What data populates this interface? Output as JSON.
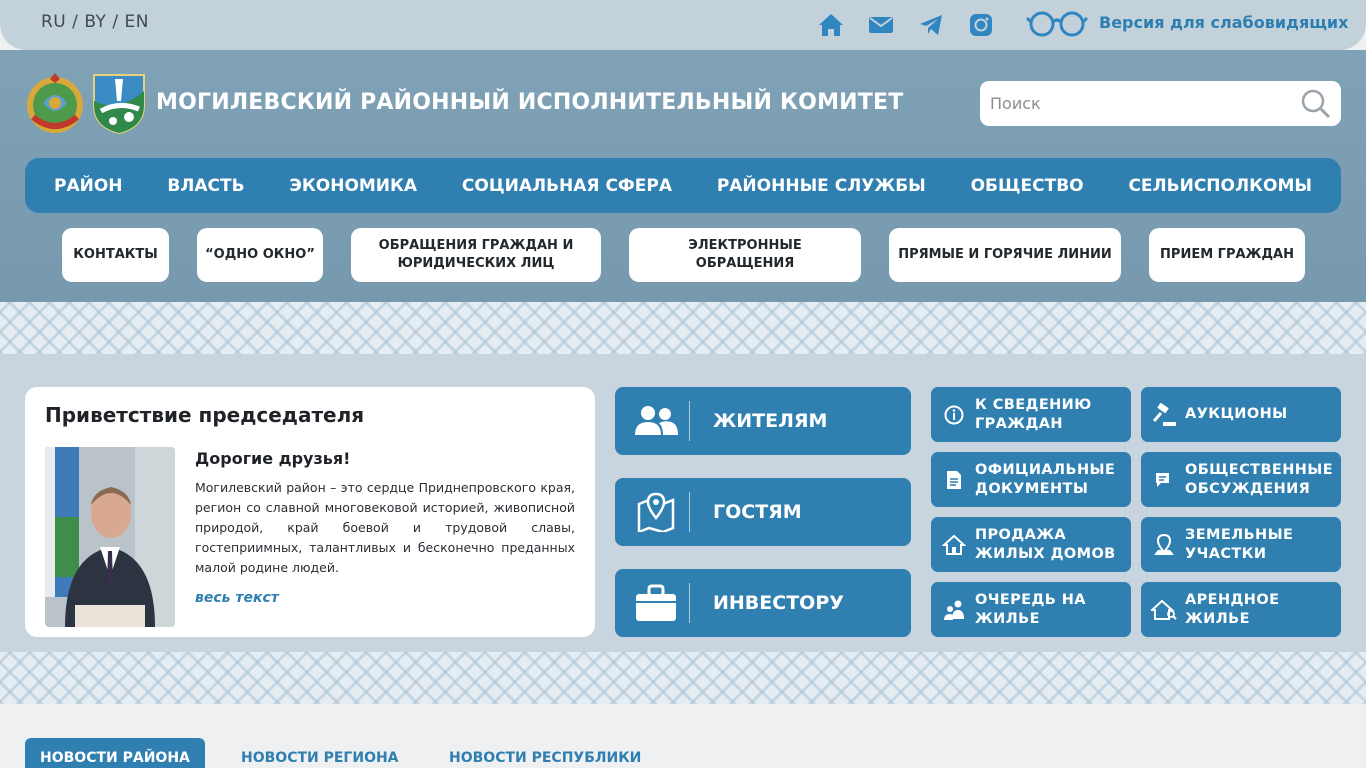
{
  "topbar": {
    "languages": [
      "RU",
      "BY",
      "EN"
    ],
    "lang_separator": " / ",
    "icons": [
      "home-icon",
      "mail-icon",
      "telegram-icon",
      "instagram-icon"
    ],
    "visually_impaired_label": "Версия для слабовидящих"
  },
  "header": {
    "title": "МОГИЛЕВСКИЙ РАЙОННЫЙ ИСПОЛНИТЕЛЬНЫЙ КОМИТЕТ",
    "search_placeholder": "Поиск"
  },
  "main_nav": [
    "РАЙОН",
    "ВЛАСТЬ",
    "ЭКОНОМИКА",
    "СОЦИАЛЬНАЯ СФЕРА",
    "РАЙОННЫЕ СЛУЖБЫ",
    "ОБЩЕСТВО",
    "СЕЛЬИСПОЛКОМЫ"
  ],
  "quick_links": [
    "КОНТАКТЫ",
    "“ОДНО ОКНО”",
    "ОБРАЩЕНИЯ ГРАЖДАН И ЮРИДИЧЕСКИХ ЛИЦ",
    "ЭЛЕКТРОННЫЕ ОБРАЩЕНИЯ",
    "ПРЯМЫЕ И ГОРЯЧИЕ ЛИНИИ",
    "ПРИЕМ ГРАЖДАН"
  ],
  "greeting": {
    "title": "Приветствие председателя",
    "salutation": "Дорогие друзья!",
    "text": "Могилевский район – это сердце Приднепровского края, регион со славной многовековой историей, живописной природой, край боевой и трудовой славы, гостеприимных, талантливых и бесконечно преданных малой родине людей.",
    "more_link": "весь текст"
  },
  "audience_buttons": [
    {
      "label": "ЖИТЕЛЯМ",
      "icon": "people-icon"
    },
    {
      "label": "ГОСТЯМ",
      "icon": "map-pin-icon"
    },
    {
      "label": "ИНВЕСТОРУ",
      "icon": "briefcase-icon"
    }
  ],
  "service_buttons": [
    {
      "label": "К СВЕДЕНИЮ ГРАЖДАН",
      "icon": "info-icon"
    },
    {
      "label": "АУКЦИОНЫ",
      "icon": "gavel-icon"
    },
    {
      "label": "ОФИЦИАЛЬНЫЕ ДОКУМЕНТЫ",
      "icon": "document-icon"
    },
    {
      "label": "ОБЩЕСТВЕННЫЕ ОБСУЖДЕНИЯ",
      "icon": "chat-icon"
    },
    {
      "label": "ПРОДАЖА ЖИЛЫХ ДОМОВ",
      "icon": "house-sale-icon"
    },
    {
      "label": "ЗЕМЕЛЬНЫЕ УЧАСТКИ",
      "icon": "land-pin-icon"
    },
    {
      "label": "ОЧЕРЕДЬ НА ЖИЛЬЕ",
      "icon": "queue-icon"
    },
    {
      "label": "АРЕНДНОЕ ЖИЛЬЕ",
      "icon": "rent-house-icon"
    }
  ],
  "news_tabs": [
    "НОВОСТИ РАЙОНА",
    "НОВОСТИ РЕГИОНА",
    "НОВОСТИ РЕСПУБЛИКИ"
  ],
  "colors": {
    "accent": "#2f7fb1",
    "header_bg": "#7c9fb4",
    "topbar_bg": "#c3d1db"
  }
}
